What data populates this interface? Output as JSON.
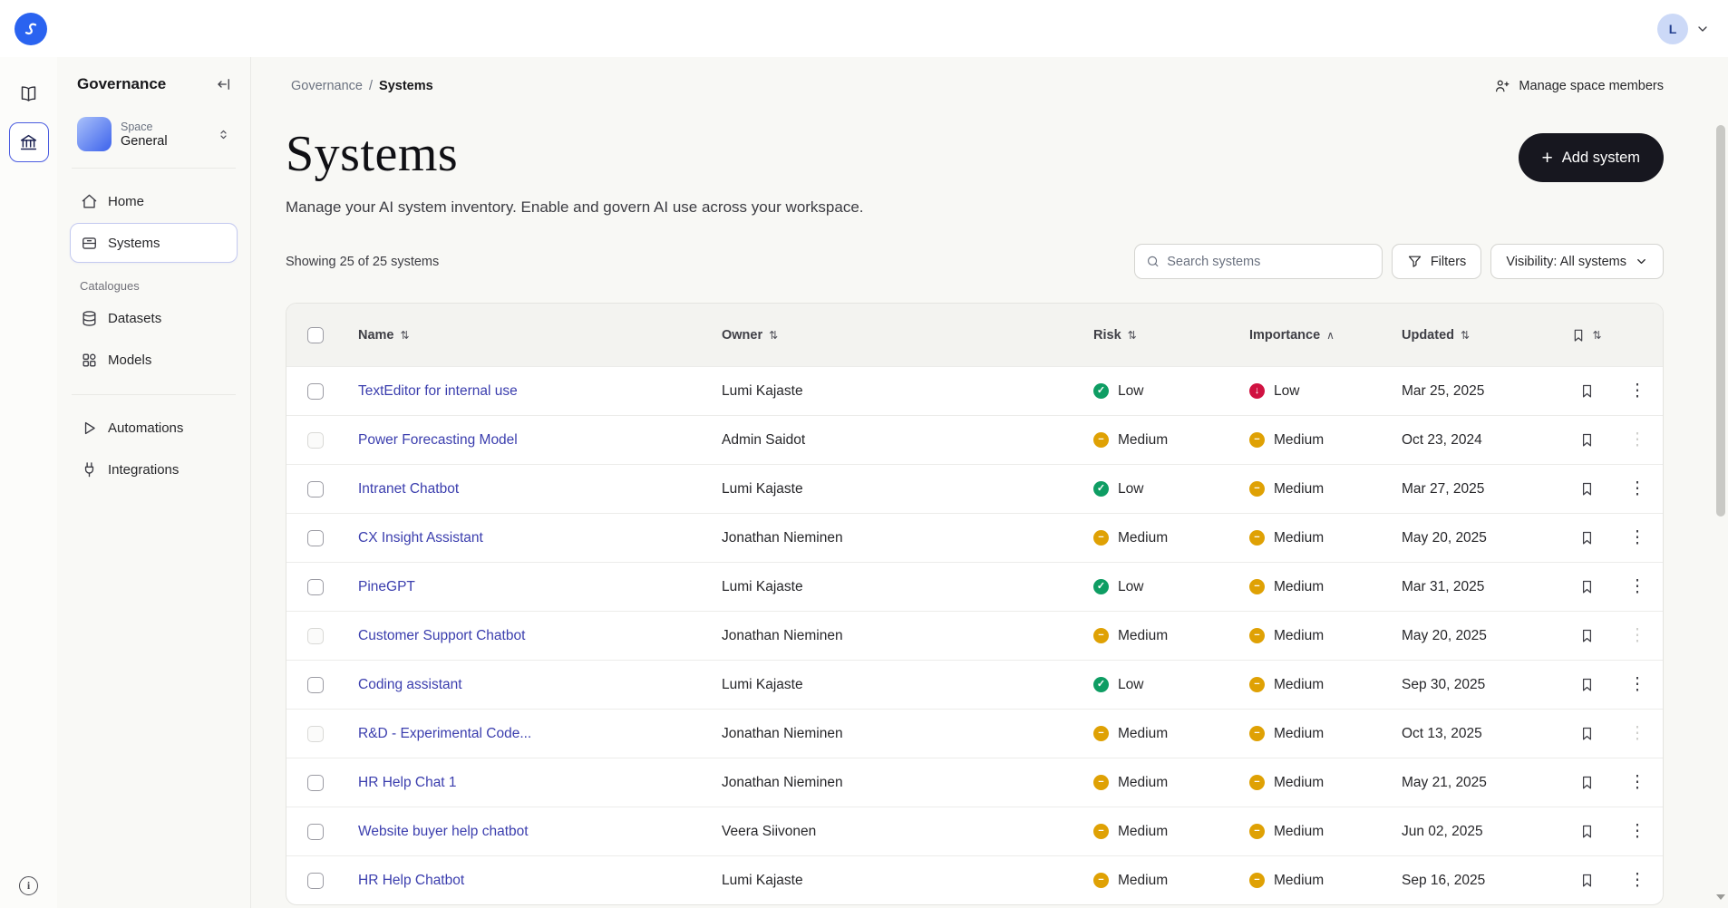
{
  "topbar": {
    "avatar_initial": "L"
  },
  "sidebar": {
    "title": "Governance",
    "space": {
      "label": "Space",
      "name": "General"
    },
    "nav": [
      {
        "label": "Home"
      },
      {
        "label": "Systems"
      }
    ],
    "section_label": "Catalogues",
    "catalogues": [
      {
        "label": "Datasets"
      },
      {
        "label": "Models"
      }
    ],
    "tools": [
      {
        "label": "Automations"
      },
      {
        "label": "Integrations"
      }
    ]
  },
  "header": {
    "breadcrumb_parent": "Governance",
    "breadcrumb_separator": "/",
    "breadcrumb_current": "Systems",
    "manage_members_label": "Manage space members"
  },
  "page": {
    "title": "Systems",
    "subtitle": "Manage your AI system inventory. Enable and govern AI use across your workspace.",
    "add_button_label": "Add system",
    "showing_text": "Showing 25 of 25 systems",
    "search_placeholder": "Search systems",
    "filters_label": "Filters",
    "visibility_label": "Visibility: All systems"
  },
  "table": {
    "columns": [
      {
        "label": "Name",
        "sort": "both"
      },
      {
        "label": "Owner",
        "sort": "both"
      },
      {
        "label": "Risk",
        "sort": "both"
      },
      {
        "label": "Importance",
        "sort": "asc"
      },
      {
        "label": "Updated",
        "sort": "both"
      }
    ],
    "rows": [
      {
        "name": "TextEditor for internal use",
        "owner": "Lumi Kajaste",
        "risk": {
          "label": "Low",
          "tone": "green"
        },
        "importance": {
          "label": "Low",
          "tone": "red"
        },
        "updated": "Mar 25, 2025",
        "muted": false
      },
      {
        "name": "Power Forecasting Model",
        "owner": "Admin Saidot",
        "risk": {
          "label": "Medium",
          "tone": "yellow"
        },
        "importance": {
          "label": "Medium",
          "tone": "yellow"
        },
        "updated": "Oct 23, 2024",
        "muted": true
      },
      {
        "name": "Intranet Chatbot",
        "owner": "Lumi Kajaste",
        "risk": {
          "label": "Low",
          "tone": "green"
        },
        "importance": {
          "label": "Medium",
          "tone": "yellow"
        },
        "updated": "Mar 27, 2025",
        "muted": false
      },
      {
        "name": "CX Insight Assistant",
        "owner": "Jonathan Nieminen",
        "risk": {
          "label": "Medium",
          "tone": "yellow"
        },
        "importance": {
          "label": "Medium",
          "tone": "yellow"
        },
        "updated": "May 20, 2025",
        "muted": false
      },
      {
        "name": "PineGPT",
        "owner": "Lumi Kajaste",
        "risk": {
          "label": "Low",
          "tone": "green"
        },
        "importance": {
          "label": "Medium",
          "tone": "yellow"
        },
        "updated": "Mar 31, 2025",
        "muted": false
      },
      {
        "name": "Customer Support Chatbot",
        "owner": "Jonathan Nieminen",
        "risk": {
          "label": "Medium",
          "tone": "yellow"
        },
        "importance": {
          "label": "Medium",
          "tone": "yellow"
        },
        "updated": "May 20, 2025",
        "muted": true
      },
      {
        "name": "Coding assistant",
        "owner": "Lumi Kajaste",
        "risk": {
          "label": "Low",
          "tone": "green"
        },
        "importance": {
          "label": "Medium",
          "tone": "yellow"
        },
        "updated": "Sep 30, 2025",
        "muted": false
      },
      {
        "name": "R&D - Experimental Code...",
        "owner": "Jonathan Nieminen",
        "risk": {
          "label": "Medium",
          "tone": "yellow"
        },
        "importance": {
          "label": "Medium",
          "tone": "yellow"
        },
        "updated": "Oct 13, 2025",
        "muted": true
      },
      {
        "name": "HR Help Chat 1",
        "owner": "Jonathan Nieminen",
        "risk": {
          "label": "Medium",
          "tone": "yellow"
        },
        "importance": {
          "label": "Medium",
          "tone": "yellow"
        },
        "updated": "May 21, 2025",
        "muted": false
      },
      {
        "name": "Website buyer help chatbot",
        "owner": "Veera Siivonen",
        "risk": {
          "label": "Medium",
          "tone": "yellow"
        },
        "importance": {
          "label": "Medium",
          "tone": "yellow"
        },
        "updated": "Jun 02, 2025",
        "muted": false
      },
      {
        "name": "HR Help Chatbot",
        "owner": "Lumi Kajaste",
        "risk": {
          "label": "Medium",
          "tone": "yellow"
        },
        "importance": {
          "label": "Medium",
          "tone": "yellow"
        },
        "updated": "Sep 16, 2025",
        "muted": false
      }
    ]
  },
  "icons": {
    "tone_glyphs": {
      "green": "✓",
      "yellow": "−",
      "red": "↓"
    },
    "sort_both": "⇅",
    "sort_asc": "∧",
    "kebab": "⋮",
    "plus": "+",
    "info": "i"
  },
  "colors": {
    "accent_blue": "#4b5ce0",
    "logo_blue": "#2a63f0",
    "link_indigo": "#3b3eae",
    "risk_low_green": "#0e9d63",
    "medium_yellow": "#dfa104",
    "importance_low_red": "#d01241",
    "add_button_dark": "#17171f"
  }
}
